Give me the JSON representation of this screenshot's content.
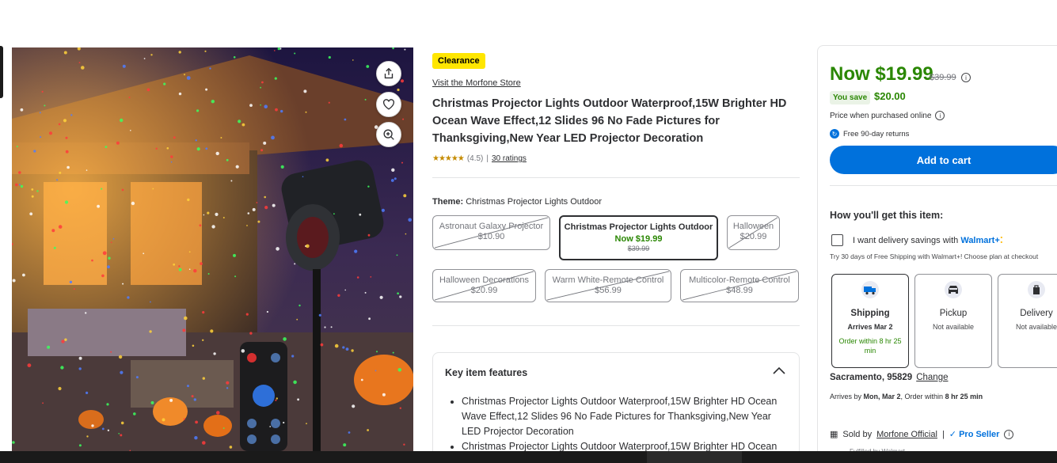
{
  "product": {
    "badge": "Clearance",
    "store_link": "Visit the Morfone Store",
    "title": "Christmas Projector Lights Outdoor Waterproof,15W Brighter HD Ocean Wave Effect,12 Slides 96 No Fade Pictures for Thanksgiving,New Year LED Projector Decoration",
    "rating_value": 4.5,
    "rating_text": "(4.5)",
    "rating_separator": "|",
    "ratings_count": "30 ratings"
  },
  "gallery": {
    "share_icon": "share-icon",
    "favorite_icon": "heart-icon",
    "zoom_icon": "zoom-in-icon"
  },
  "theme": {
    "label": "Theme:",
    "selected": "Christmas Projector Lights Outdoor",
    "options": [
      {
        "name": "Astronaut Galaxy Projector",
        "price": "$10.90",
        "available": false
      },
      {
        "name": "Christmas Projector Lights Outdoor",
        "price": "Now $19.99",
        "was": "$39.99",
        "available": true,
        "selected": true
      },
      {
        "name": "Halloween",
        "price": "$20.99",
        "available": false
      },
      {
        "name": "Halloween Decorations",
        "price": "$20.99",
        "available": false
      },
      {
        "name": "Warm White-Remote Control",
        "price": "$56.99",
        "available": false
      },
      {
        "name": "Multicolor-Remote Control",
        "price": "$48.99",
        "available": false
      }
    ]
  },
  "features": {
    "heading": "Key item features",
    "items": [
      "Christmas Projector Lights Outdoor Waterproof,15W Brighter HD Ocean Wave Effect,12 Slides 96 No Fade Pictures for Thanksgiving,New Year LED Projector Decoration",
      "Christmas Projector Lights Outdoor Waterproof,15W Brighter HD Ocean"
    ]
  },
  "buybox": {
    "now_price": "Now $19.99",
    "was_price": "$39.99",
    "info_glyph": "i",
    "you_save_label": "You save",
    "you_save_amount": "$20.00",
    "online_note": "Price when purchased online",
    "returns": "Free 90-day returns",
    "add_to_cart": "Add to cart",
    "how_heading": "How you'll get this item:",
    "delivery_savings": "I want delivery savings with",
    "walmart_plus": "Walmart+",
    "trial_text": "Try 30 days of Free Shipping with Walmart+! Choose plan at checkout",
    "fulfillment": [
      {
        "label": "Shipping",
        "sub": "Arrives Mar 2",
        "note": "Order within 8 hr 25 min",
        "selected": true,
        "icon": "truck-icon"
      },
      {
        "label": "Pickup",
        "sub": "Not available",
        "note": "",
        "selected": false,
        "icon": "car-icon"
      },
      {
        "label": "Delivery",
        "sub": "Not available",
        "note": "",
        "selected": false,
        "icon": "bag-icon"
      }
    ],
    "location": "Sacramento, 95829",
    "change_link": "Change",
    "arrives_prefix": "Arrives by",
    "arrives_date": "Mon, Mar 2",
    "order_within_prefix": ", Order within",
    "order_within_time": "8 hr 25 min",
    "sold_by_prefix": "Sold by",
    "seller": "Morfone Official",
    "pro_seller": "Pro Seller",
    "fulfilled_by": "Fulfilled by Walmart"
  },
  "colors": {
    "accent_blue": "#0071dc",
    "price_green": "#2a8703",
    "clearance_yellow": "#ffe600",
    "text": "#2e2f32"
  }
}
